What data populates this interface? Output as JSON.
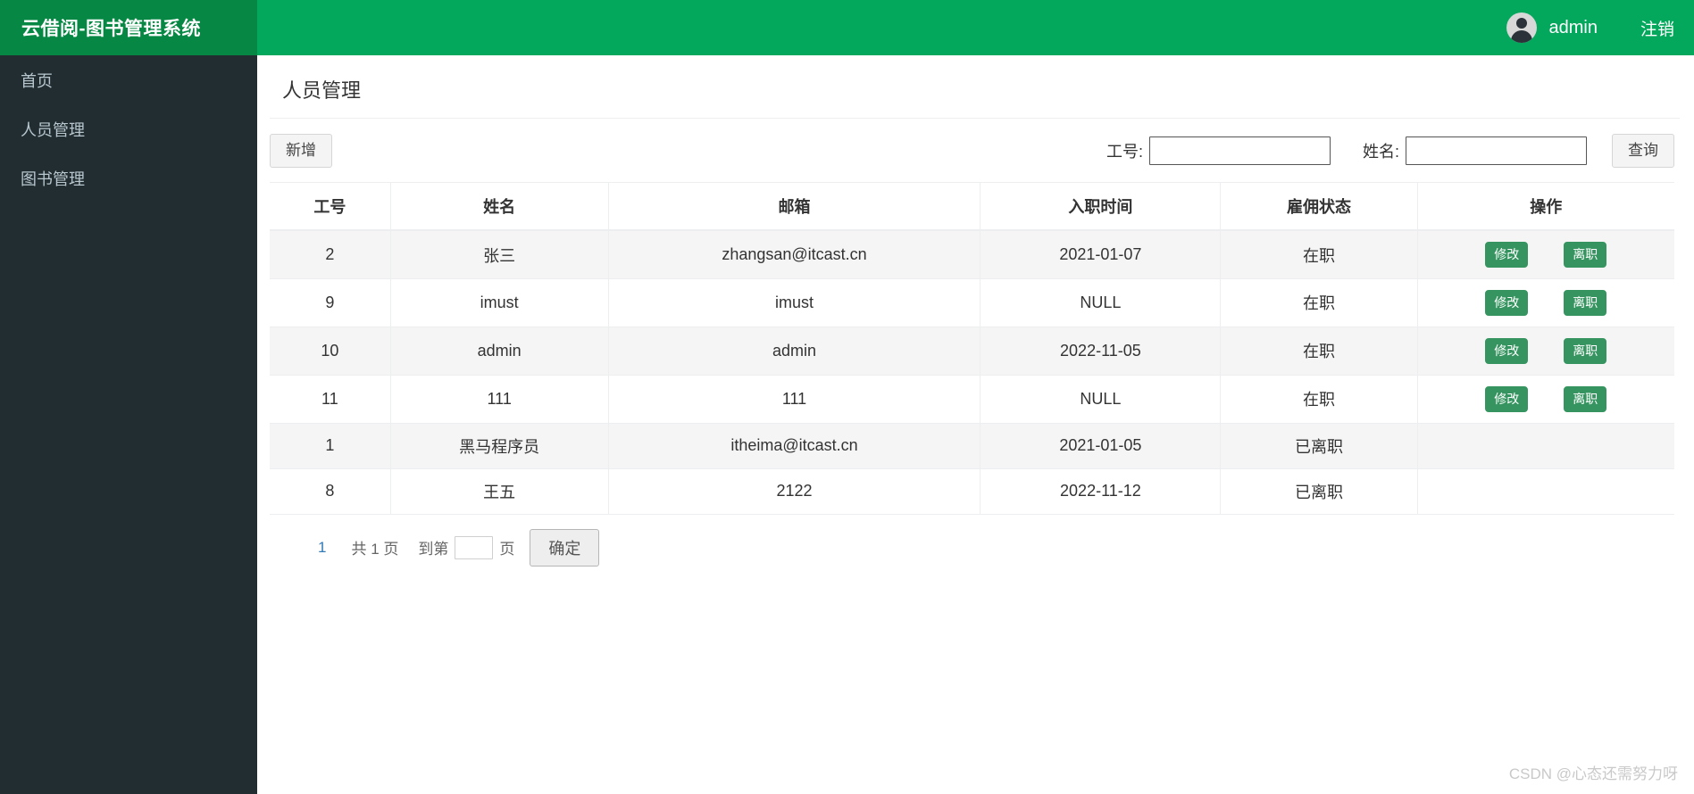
{
  "header": {
    "brand_title": "云借阅-图书管理系统",
    "user_name": "admin",
    "logout_label": "注销",
    "brand_bg": "#068743",
    "bar_bg": "#04a85c"
  },
  "sidebar": {
    "bg": "#222d32",
    "items": [
      {
        "label": "首页"
      },
      {
        "label": "人员管理"
      },
      {
        "label": "图书管理"
      }
    ]
  },
  "main": {
    "page_title": "人员管理",
    "toolbar": {
      "add_label": "新增",
      "emp_id_label": "工号:",
      "emp_id_value": "",
      "name_label": "姓名:",
      "name_value": "",
      "query_label": "查询"
    },
    "table": {
      "columns": [
        "工号",
        "姓名",
        "邮箱",
        "入职时间",
        "雇佣状态",
        "操作"
      ],
      "edit_label": "修改",
      "resign_label": "离职",
      "action_color": "#35945f",
      "rows": [
        {
          "id": "2",
          "name": "张三",
          "email": "zhangsan@itcast.cn",
          "hire_date": "2021-01-07",
          "status": "在职",
          "has_actions": true
        },
        {
          "id": "9",
          "name": "imust",
          "email": "imust",
          "hire_date": "NULL",
          "status": "在职",
          "has_actions": true
        },
        {
          "id": "10",
          "name": "admin",
          "email": "admin",
          "hire_date": "2022-11-05",
          "status": "在职",
          "has_actions": true
        },
        {
          "id": "11",
          "name": "111",
          "email": "111",
          "hire_date": "NULL",
          "status": "在职",
          "has_actions": true
        },
        {
          "id": "1",
          "name": "黑马程序员",
          "email": "itheima@itcast.cn",
          "hire_date": "2021-01-05",
          "status": "已离职",
          "has_actions": false
        },
        {
          "id": "8",
          "name": "王五",
          "email": "2122",
          "hire_date": "2022-11-12",
          "status": "已离职",
          "has_actions": false
        }
      ]
    },
    "pagination": {
      "current_page": "1",
      "total_text": "共 1 页",
      "goto_prefix": "到第",
      "goto_value": "",
      "goto_suffix": "页",
      "confirm_label": "确定"
    }
  },
  "watermark": {
    "text": "CSDN @心态还需努力呀"
  }
}
